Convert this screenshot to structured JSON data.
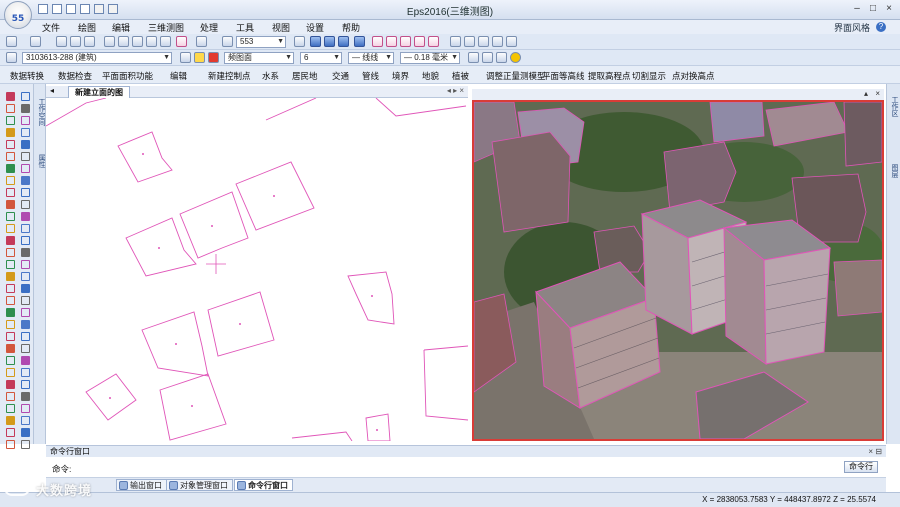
{
  "app": {
    "title": "Eps2016(三维测图)",
    "logo_top": "",
    "logo_bottom": "55",
    "theme_label": "界面风格",
    "help": "?"
  },
  "menu": [
    "文件",
    "绘图",
    "编辑",
    "三维测图",
    "处理",
    "工具",
    "视图",
    "设置",
    "帮助"
  ],
  "toolbar": {
    "zoom_value": "553",
    "layer_combo": "3103613-288 (建筑)",
    "style_combo": "频图面",
    "color_combo": "6",
    "line_combo": "— 线线",
    "width_combo": "— 0.18 毫米"
  },
  "toolbar3": [
    "数据转换",
    "数据检查",
    "平面面积功能",
    "编辑",
    "新建控制点",
    "水系",
    "居民地",
    "交通",
    "管线",
    "境界",
    "地貌",
    "植被",
    "调整正量测模型",
    "平面等高线",
    "提取高程点",
    "切割显示",
    "点对换高点"
  ],
  "doc_tab": "新建立面的图",
  "command": {
    "header": "命令行窗口",
    "prompt": "命令:",
    "button": "命令行"
  },
  "bottom_tabs": [
    "输出窗口",
    "对象管理窗口",
    "命令行窗口"
  ],
  "status": {
    "left": "",
    "coords": "X = 2838053.7583 Y = 448437.8972 Z = 25.5574"
  },
  "watermark": "大数跨境",
  "colors": {
    "accent": "#d93c37",
    "parcel": "#e055b8",
    "toolbar_bg": "#dfe8f5"
  }
}
